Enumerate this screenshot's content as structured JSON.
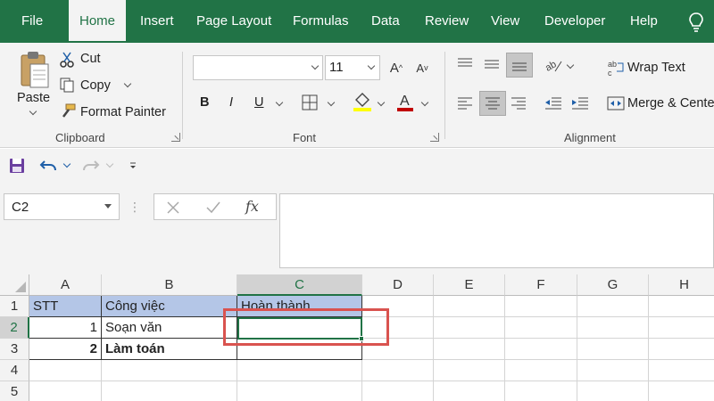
{
  "tabs": [
    "File",
    "Home",
    "Insert",
    "Page Layout",
    "Formulas",
    "Data",
    "Review",
    "View",
    "Developer",
    "Help"
  ],
  "ribbon": {
    "clipboard": {
      "paste": "Paste",
      "cut": "Cut",
      "copy": "Copy",
      "format_painter": "Format Painter",
      "label": "Clipboard"
    },
    "font": {
      "font_name": "",
      "font_size": "11",
      "bold": "B",
      "italic": "I",
      "underline": "U",
      "label": "Font"
    },
    "alignment": {
      "wrap_text": "Wrap Text",
      "merge_center": "Merge & Center",
      "label": "Alignment"
    }
  },
  "formula_bar": {
    "name_box": "C2",
    "fx": "fx",
    "content": ""
  },
  "grid": {
    "columns": [
      "A",
      "B",
      "C",
      "D",
      "E",
      "F",
      "G",
      "H"
    ],
    "selected_column": "C",
    "rows": [
      "1",
      "2",
      "3",
      "4",
      "5"
    ],
    "selected_row": "2",
    "cells": {
      "A1": "STT",
      "B1": "Công việc",
      "C1": "Hoàn thành",
      "A2": "1",
      "B2": "Soạn văn",
      "C2": "",
      "A3": "2",
      "B3": "Làm toán",
      "C3": ""
    }
  },
  "colors": {
    "accent": "#217346",
    "header_fill": "#b4c6e7",
    "highlight": "#d9534f",
    "font_color_bar": "#c00000",
    "fill_color_bar": "#ffff00"
  }
}
